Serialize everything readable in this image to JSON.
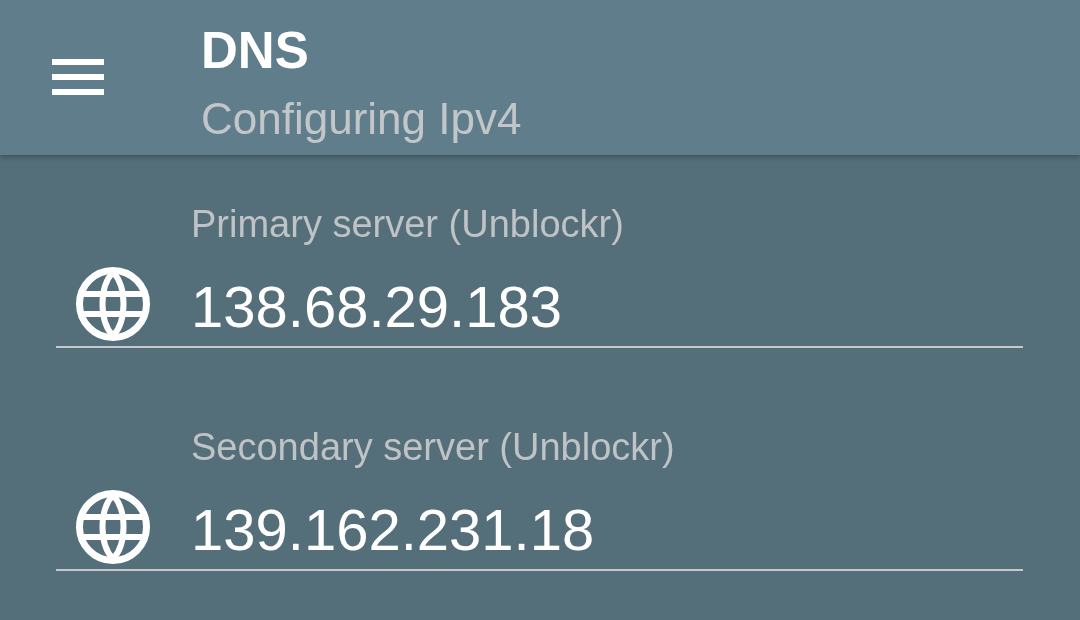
{
  "toolbar": {
    "title": "DNS",
    "subtitle": "Configuring Ipv4"
  },
  "fields": [
    {
      "label": "Primary server (Unblockr)",
      "value": "138.68.29.183"
    },
    {
      "label": "Secondary server (Unblockr)",
      "value": "139.162.231.18"
    }
  ]
}
